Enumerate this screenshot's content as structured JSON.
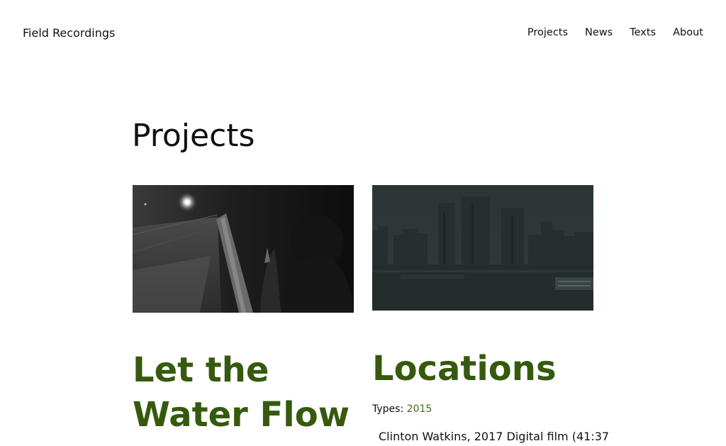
{
  "header": {
    "site_title": "Field Recordings",
    "nav": [
      {
        "label": "Projects"
      },
      {
        "label": "News"
      },
      {
        "label": "Texts"
      },
      {
        "label": "About"
      }
    ]
  },
  "main": {
    "page_title": "Projects",
    "projects": [
      {
        "title": "Let the Water Flow",
        "image_description": "night-train-still"
      },
      {
        "title": "Locations",
        "types_label": "Types:",
        "types_value": "2015",
        "description": "Clinton Watkins, 2017 Digital film (41:37"
      }
    ]
  },
  "colors": {
    "accent": "#355a0e",
    "link": "#3f6e12",
    "text": "#111111",
    "background": "#ffffff"
  }
}
